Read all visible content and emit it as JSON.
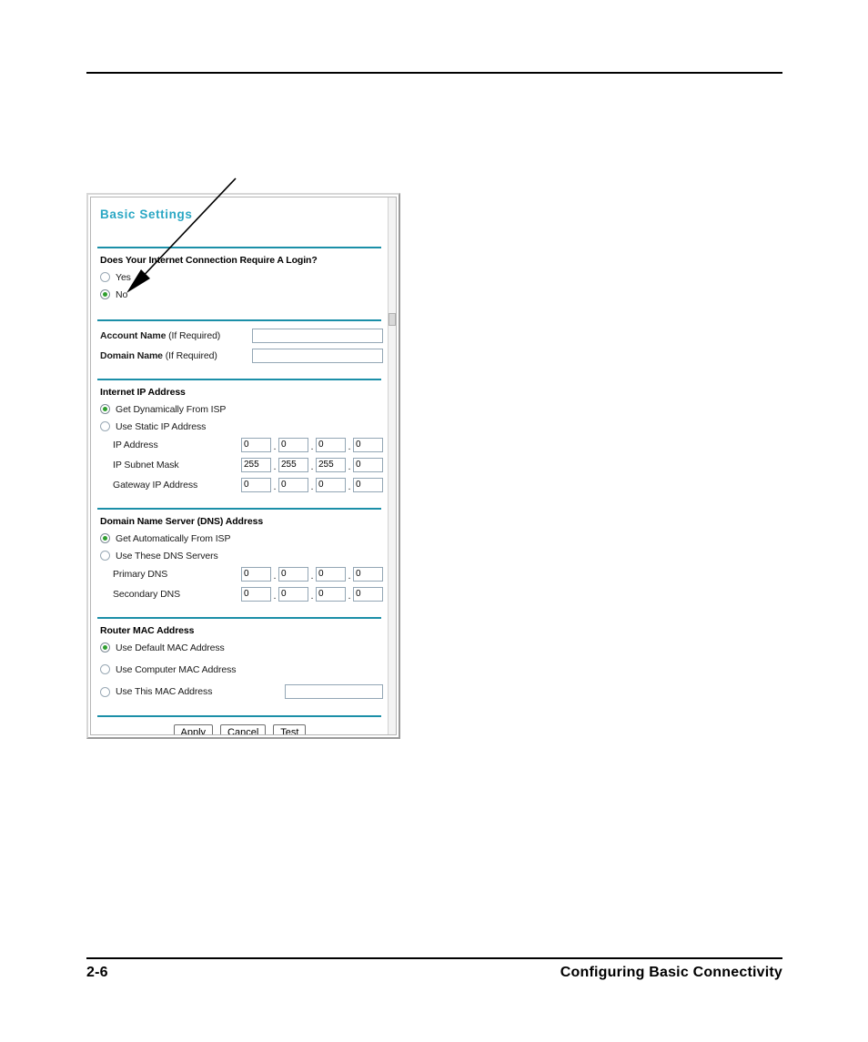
{
  "page": {
    "footer_left": "2-6",
    "footer_right": "Configuring Basic Connectivity"
  },
  "panel": {
    "title": "Basic Settings",
    "login_section": {
      "heading": "Does Your Internet Connection Require A Login?",
      "options": [
        {
          "label": "Yes",
          "selected": false
        },
        {
          "label": "No",
          "selected": true
        }
      ]
    },
    "account_section": {
      "account_name_label_bold": "Account Name",
      "account_name_label_note": " (If Required)",
      "account_name_value": "",
      "domain_name_label_bold": "Domain Name",
      "domain_name_label_note": " (If Required)",
      "domain_name_value": ""
    },
    "internet_ip_section": {
      "heading": "Internet IP Address",
      "options": [
        {
          "label": "Get Dynamically From ISP",
          "selected": true
        },
        {
          "label": "Use Static IP Address",
          "selected": false
        }
      ],
      "fields": [
        {
          "label": "IP Address",
          "octets": [
            "0",
            "0",
            "0",
            "0"
          ]
        },
        {
          "label": "IP Subnet Mask",
          "octets": [
            "255",
            "255",
            "255",
            "0"
          ]
        },
        {
          "label": "Gateway IP Address",
          "octets": [
            "0",
            "0",
            "0",
            "0"
          ]
        }
      ]
    },
    "dns_section": {
      "heading": "Domain Name Server (DNS) Address",
      "options": [
        {
          "label": "Get Automatically From ISP",
          "selected": true
        },
        {
          "label": "Use These DNS Servers",
          "selected": false
        }
      ],
      "fields": [
        {
          "label": "Primary DNS",
          "octets": [
            "0",
            "0",
            "0",
            "0"
          ]
        },
        {
          "label": "Secondary DNS",
          "octets": [
            "0",
            "0",
            "0",
            "0"
          ]
        }
      ]
    },
    "mac_section": {
      "heading": "Router MAC Address",
      "options": [
        {
          "label": "Use Default MAC Address",
          "selected": true
        },
        {
          "label": "Use Computer MAC Address",
          "selected": false
        },
        {
          "label": "Use This MAC Address",
          "selected": false
        }
      ],
      "mac_value": ""
    },
    "buttons": [
      {
        "label": "Apply"
      },
      {
        "label": "Cancel"
      },
      {
        "label": "Test"
      }
    ]
  },
  "colors": {
    "title": "#2aa7c4",
    "divider": "#1b8fa8",
    "radio_dot": "#2f9e2f",
    "input_border": "#93a6b5"
  }
}
